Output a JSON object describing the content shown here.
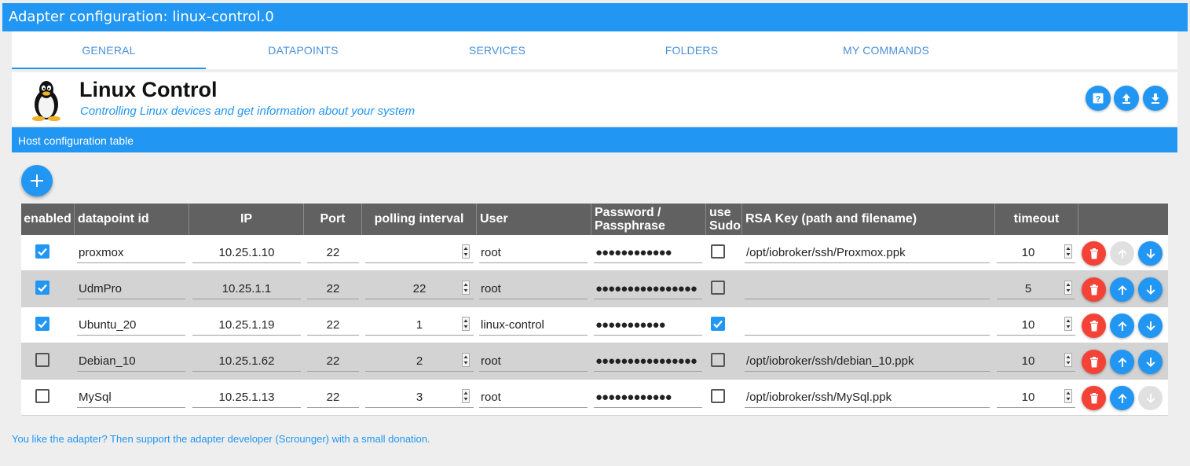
{
  "window": {
    "title": "Adapter configuration: linux-control.0"
  },
  "tabs": [
    {
      "label": "GENERAL",
      "active": true
    },
    {
      "label": "DATAPOINTS",
      "active": false
    },
    {
      "label": "SERVICES",
      "active": false
    },
    {
      "label": "FOLDERS",
      "active": false
    },
    {
      "label": "MY COMMANDS",
      "active": false
    }
  ],
  "header": {
    "title": "Linux Control",
    "subtitle": "Controlling Linux devices and get information about your system",
    "buttons": [
      "help-icon",
      "upload-icon",
      "download-icon"
    ]
  },
  "section": {
    "title": "Host configuration table"
  },
  "table": {
    "columns": [
      "enabled",
      "datapoint id",
      "IP",
      "Port",
      "polling interval",
      "User",
      "Password /",
      "Passphrase",
      "use",
      "Sudo",
      "RSA Key (path and filename)",
      "timeout"
    ],
    "rows": [
      {
        "enabled": true,
        "id": "proxmox",
        "ip": "10.25.1.10",
        "port": "22",
        "polling": "",
        "user": "root",
        "password": "●●●●●●●●●●●●",
        "sudo": false,
        "rsa": "/opt/iobroker/ssh/Proxmox.ppk",
        "timeout": "10",
        "up_enabled": false,
        "down_enabled": true
      },
      {
        "enabled": true,
        "id": "UdmPro",
        "ip": "10.25.1.1",
        "port": "22",
        "polling": "22",
        "user": "root",
        "password": "●●●●●●●●●●●●●●●●",
        "sudo": false,
        "rsa": "",
        "timeout": "5",
        "up_enabled": true,
        "down_enabled": true
      },
      {
        "enabled": true,
        "id": "Ubuntu_20",
        "ip": "10.25.1.19",
        "port": "22",
        "polling": "1",
        "user": "linux-control",
        "password": "●●●●●●●●●●●",
        "sudo": true,
        "rsa": "",
        "timeout": "10",
        "up_enabled": true,
        "down_enabled": true
      },
      {
        "enabled": false,
        "id": "Debian_10",
        "ip": "10.25.1.62",
        "port": "22",
        "polling": "2",
        "user": "root",
        "password": "●●●●●●●●●●●●●●●●",
        "sudo": false,
        "rsa": "/opt/iobroker/ssh/debian_10.ppk",
        "timeout": "10",
        "up_enabled": true,
        "down_enabled": true
      },
      {
        "enabled": false,
        "id": "MySql",
        "ip": "10.25.1.13",
        "port": "22",
        "polling": "3",
        "user": "root",
        "password": "●●●●●●●●●●●●",
        "sudo": false,
        "rsa": "/opt/iobroker/ssh/MySql.ppk",
        "timeout": "10",
        "up_enabled": true,
        "down_enabled": false
      }
    ]
  },
  "footer": {
    "text": "You like the adapter? Then support the adapter developer (Scrounger) with a small donation."
  },
  "colors": {
    "primary": "#2196f3",
    "delete": "#f44336",
    "table_header": "#616161",
    "disabled": "#e0e0e0"
  }
}
